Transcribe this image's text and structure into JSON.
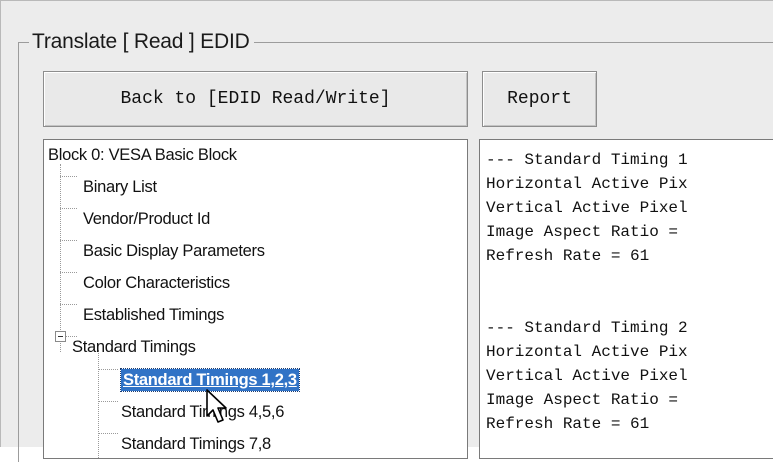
{
  "group": {
    "title": "Translate [ Read ] EDID"
  },
  "toolbar": {
    "back_label": "Back to [EDID Read/Write]",
    "report_label": "Report"
  },
  "tree": {
    "root": "Block 0: VESA Basic Block",
    "items": [
      "Binary List",
      "Vendor/Product Id",
      "Basic Display Parameters",
      "Color Characteristics",
      "Established Timings",
      "Standard Timings"
    ],
    "children": [
      "Standard Timings 1,2,3",
      "Standard Timings 4,5,6",
      "Standard Timings 7,8"
    ],
    "selected_index": 0
  },
  "report": {
    "lines": [
      "--- Standard Timing 1",
      "Horizontal Active Pix",
      "Vertical Active Pixel",
      "Image Aspect Ratio =",
      "Refresh Rate = 61",
      "",
      "--- Standard Timing 2",
      "Horizontal Active Pix",
      "Vertical Active Pixel",
      "Image Aspect Ratio =",
      "Refresh Rate = 61"
    ]
  }
}
